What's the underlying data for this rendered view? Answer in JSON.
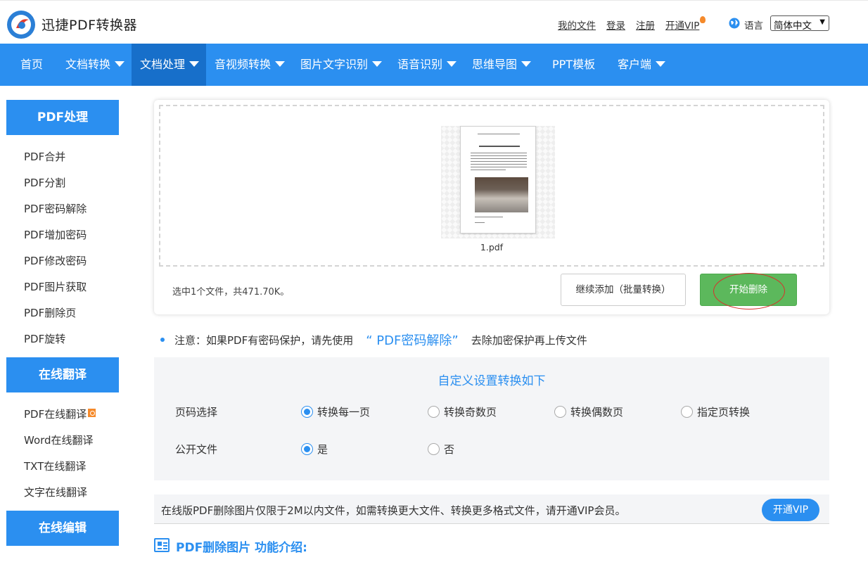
{
  "header": {
    "brand": "迅捷PDF转换器",
    "links": [
      "我的文件",
      "登录",
      "注册",
      "开通VIP"
    ],
    "lang_label": "语言",
    "lang_value": "简体中文"
  },
  "nav": {
    "items": [
      {
        "label": "首页"
      },
      {
        "label": "文档转换"
      },
      {
        "label": "文档处理"
      },
      {
        "label": "音视频转换"
      },
      {
        "label": "图片文字识别"
      },
      {
        "label": "语音识别"
      },
      {
        "label": "思维导图"
      },
      {
        "label": "PPT模板"
      },
      {
        "label": "客户端"
      }
    ]
  },
  "sidebar": {
    "pdf_head": "PDF处理",
    "pdf_items": [
      "PDF合并",
      "PDF分割",
      "PDF密码解除",
      "PDF增加密码",
      "PDF修改密码",
      "PDF图片获取",
      "PDF删除页",
      "PDF旋转"
    ],
    "translate_head": "在线翻译",
    "translate_items": [
      "PDF在线翻译",
      "Word在线翻译",
      "TXT在线翻译",
      "文字在线翻译"
    ],
    "edit_head": "在线编辑"
  },
  "upload": {
    "file_name": "1.pdf",
    "selection_text": "选中1个文件，共471.70K。",
    "add_button": "继续添加（批量转换）",
    "start_button": "开始删除"
  },
  "notice": {
    "prefix": "注意：如果PDF有密码保护，请先使用",
    "link": "“ PDF密码解除”",
    "suffix": "去除加密保护再上传文件"
  },
  "settings": {
    "title": "自定义设置转换如下",
    "page_label": "页码选择",
    "page_options": [
      "转换每一页",
      "转换奇数页",
      "转换偶数页",
      "指定页转换"
    ],
    "public_label": "公开文件",
    "public_options": [
      "是",
      "否"
    ]
  },
  "limit": {
    "text": "在线版PDF删除图片仅限于2M以内文件，如需转换更大文件、转换更多格式文件，请开通VIP会员。",
    "vip_button": "开通VIP"
  },
  "intro": {
    "title": "PDF删除图片 功能介绍:"
  },
  "colors": {
    "primary": "#2b8ff0",
    "nav_active": "#176fca",
    "success": "#5cb85c",
    "accent_orange": "#f58a2b",
    "annotation_red": "#d9302c"
  }
}
